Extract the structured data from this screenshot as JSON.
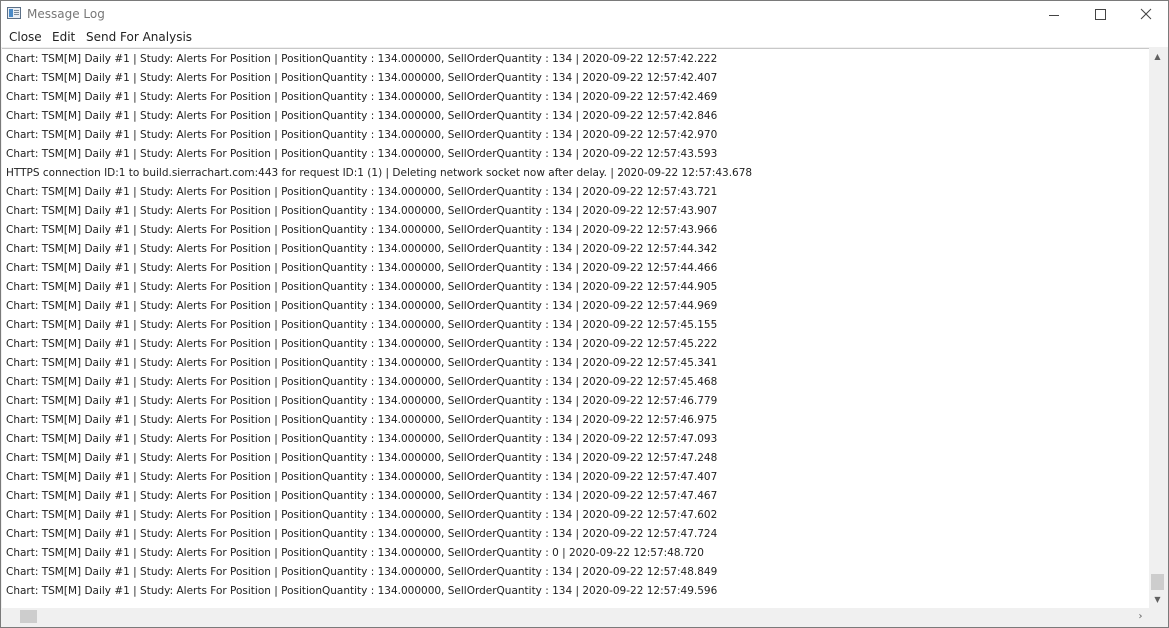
{
  "window": {
    "title": "Message Log",
    "icons": {
      "app": "message-log-app-icon",
      "minimize": "minimize-icon",
      "maximize": "maximize-icon",
      "close": "close-x-icon"
    }
  },
  "menu": {
    "close": "Close",
    "edit": "Edit",
    "send": "Send For Analysis"
  },
  "log": [
    "Chart: TSM[M]  Daily  #1 | Study: Alerts For Position | PositionQuantity : 134.000000, SellOrderQuantity : 134 | 2020-09-22  12:57:42.222",
    "Chart: TSM[M]  Daily  #1 | Study: Alerts For Position | PositionQuantity : 134.000000, SellOrderQuantity : 134 | 2020-09-22  12:57:42.407",
    "Chart: TSM[M]  Daily  #1 | Study: Alerts For Position | PositionQuantity : 134.000000, SellOrderQuantity : 134 | 2020-09-22  12:57:42.469",
    "Chart: TSM[M]  Daily  #1 | Study: Alerts For Position | PositionQuantity : 134.000000, SellOrderQuantity : 134 | 2020-09-22  12:57:42.846",
    "Chart: TSM[M]  Daily  #1 | Study: Alerts For Position | PositionQuantity : 134.000000, SellOrderQuantity : 134 | 2020-09-22  12:57:42.970",
    "Chart: TSM[M]  Daily  #1 | Study: Alerts For Position | PositionQuantity : 134.000000, SellOrderQuantity : 134 | 2020-09-22  12:57:43.593",
    "HTTPS connection ID:1 to build.sierrachart.com:443 for request ID:1 (1) | Deleting network socket now after delay. | 2020-09-22  12:57:43.678",
    "Chart: TSM[M]  Daily  #1 | Study: Alerts For Position | PositionQuantity : 134.000000, SellOrderQuantity : 134 | 2020-09-22  12:57:43.721",
    "Chart: TSM[M]  Daily  #1 | Study: Alerts For Position | PositionQuantity : 134.000000, SellOrderQuantity : 134 | 2020-09-22  12:57:43.907",
    "Chart: TSM[M]  Daily  #1 | Study: Alerts For Position | PositionQuantity : 134.000000, SellOrderQuantity : 134 | 2020-09-22  12:57:43.966",
    "Chart: TSM[M]  Daily  #1 | Study: Alerts For Position | PositionQuantity : 134.000000, SellOrderQuantity : 134 | 2020-09-22  12:57:44.342",
    "Chart: TSM[M]  Daily  #1 | Study: Alerts For Position | PositionQuantity : 134.000000, SellOrderQuantity : 134 | 2020-09-22  12:57:44.466",
    "Chart: TSM[M]  Daily  #1 | Study: Alerts For Position | PositionQuantity : 134.000000, SellOrderQuantity : 134 | 2020-09-22  12:57:44.905",
    "Chart: TSM[M]  Daily  #1 | Study: Alerts For Position | PositionQuantity : 134.000000, SellOrderQuantity : 134 | 2020-09-22  12:57:44.969",
    "Chart: TSM[M]  Daily  #1 | Study: Alerts For Position | PositionQuantity : 134.000000, SellOrderQuantity : 134 | 2020-09-22  12:57:45.155",
    "Chart: TSM[M]  Daily  #1 | Study: Alerts For Position | PositionQuantity : 134.000000, SellOrderQuantity : 134 | 2020-09-22  12:57:45.222",
    "Chart: TSM[M]  Daily  #1 | Study: Alerts For Position | PositionQuantity : 134.000000, SellOrderQuantity : 134 | 2020-09-22  12:57:45.341",
    "Chart: TSM[M]  Daily  #1 | Study: Alerts For Position | PositionQuantity : 134.000000, SellOrderQuantity : 134 | 2020-09-22  12:57:45.468",
    "Chart: TSM[M]  Daily  #1 | Study: Alerts For Position | PositionQuantity : 134.000000, SellOrderQuantity : 134 | 2020-09-22  12:57:46.779",
    "Chart: TSM[M]  Daily  #1 | Study: Alerts For Position | PositionQuantity : 134.000000, SellOrderQuantity : 134 | 2020-09-22  12:57:46.975",
    "Chart: TSM[M]  Daily  #1 | Study: Alerts For Position | PositionQuantity : 134.000000, SellOrderQuantity : 134 | 2020-09-22  12:57:47.093",
    "Chart: TSM[M]  Daily  #1 | Study: Alerts For Position | PositionQuantity : 134.000000, SellOrderQuantity : 134 | 2020-09-22  12:57:47.248",
    "Chart: TSM[M]  Daily  #1 | Study: Alerts For Position | PositionQuantity : 134.000000, SellOrderQuantity : 134 | 2020-09-22  12:57:47.407",
    "Chart: TSM[M]  Daily  #1 | Study: Alerts For Position | PositionQuantity : 134.000000, SellOrderQuantity : 134 | 2020-09-22  12:57:47.467",
    "Chart: TSM[M]  Daily  #1 | Study: Alerts For Position | PositionQuantity : 134.000000, SellOrderQuantity : 134 | 2020-09-22  12:57:47.602",
    "Chart: TSM[M]  Daily  #1 | Study: Alerts For Position | PositionQuantity : 134.000000, SellOrderQuantity : 134 | 2020-09-22  12:57:47.724",
    "Chart: TSM[M]  Daily  #1 | Study: Alerts For Position | PositionQuantity : 134.000000, SellOrderQuantity : 0 | 2020-09-22  12:57:48.720",
    "Chart: TSM[M]  Daily  #1 | Study: Alerts For Position | PositionQuantity : 134.000000, SellOrderQuantity : 134 | 2020-09-22  12:57:48.849",
    "Chart: TSM[M]  Daily  #1 | Study: Alerts For Position | PositionQuantity : 134.000000, SellOrderQuantity : 134 | 2020-09-22  12:57:49.596"
  ],
  "scrollbars": {
    "up_icon": "scroll-up-arrow-icon",
    "down_icon": "scroll-down-arrow-icon",
    "left_icon": "scroll-left-arrow-icon",
    "right_icon": "scroll-right-arrow-icon"
  }
}
